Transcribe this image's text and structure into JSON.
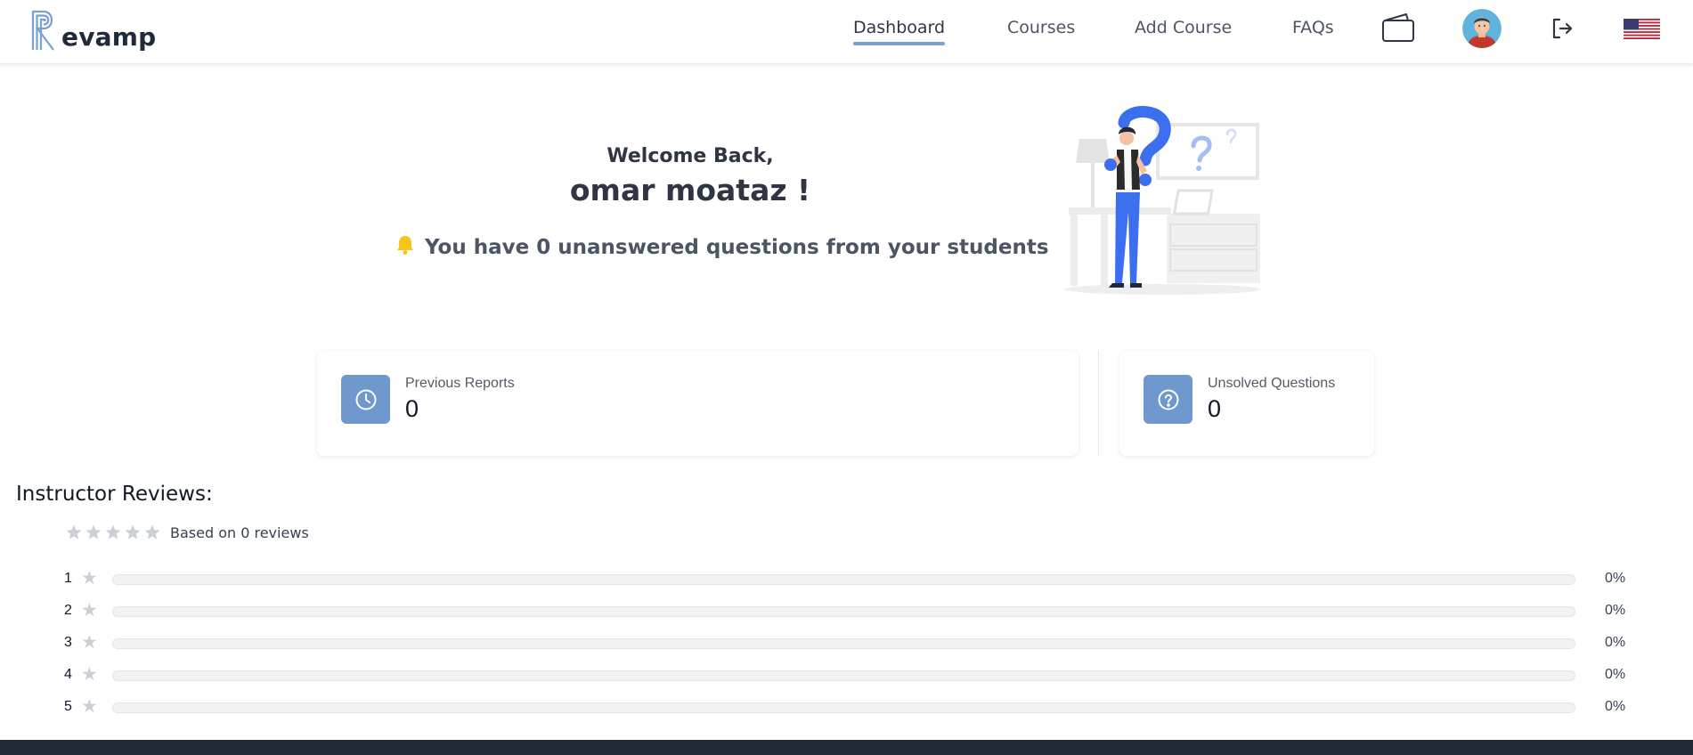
{
  "brand": {
    "name": "evamp"
  },
  "nav": {
    "items": [
      {
        "label": "Dashboard",
        "active": true
      },
      {
        "label": "Courses",
        "active": false
      },
      {
        "label": "Add Course",
        "active": false
      },
      {
        "label": "FAQs",
        "active": false
      }
    ],
    "icons": [
      "wallet-icon",
      "avatar",
      "logout-icon",
      "us-flag-icon"
    ]
  },
  "welcome": {
    "greeting": "Welcome Back,",
    "name": "omar moataz !",
    "notice": "You have 0 unanswered questions from your students"
  },
  "stats": [
    {
      "label": "Previous Reports",
      "value": "0",
      "icon": "clock-icon"
    },
    {
      "label": "Unsolved Questions",
      "value": "0",
      "icon": "question-circle-icon"
    }
  ],
  "reviews": {
    "title": "Instructor Reviews:",
    "summary_text": "Based on 0 reviews",
    "average_stars": 0,
    "breakdown": [
      {
        "stars": "1",
        "percent": "0%",
        "fraction": 0
      },
      {
        "stars": "2",
        "percent": "0%",
        "fraction": 0
      },
      {
        "stars": "3",
        "percent": "0%",
        "fraction": 0
      },
      {
        "stars": "4",
        "percent": "0%",
        "fraction": 0
      },
      {
        "stars": "5",
        "percent": "0%",
        "fraction": 0
      }
    ]
  },
  "colors": {
    "accent": "#6f98cf",
    "nav_underline": "#7a9fd1",
    "bell": "#f5c518",
    "star_empty": "#cbd0d6",
    "footer": "#1f2937"
  }
}
